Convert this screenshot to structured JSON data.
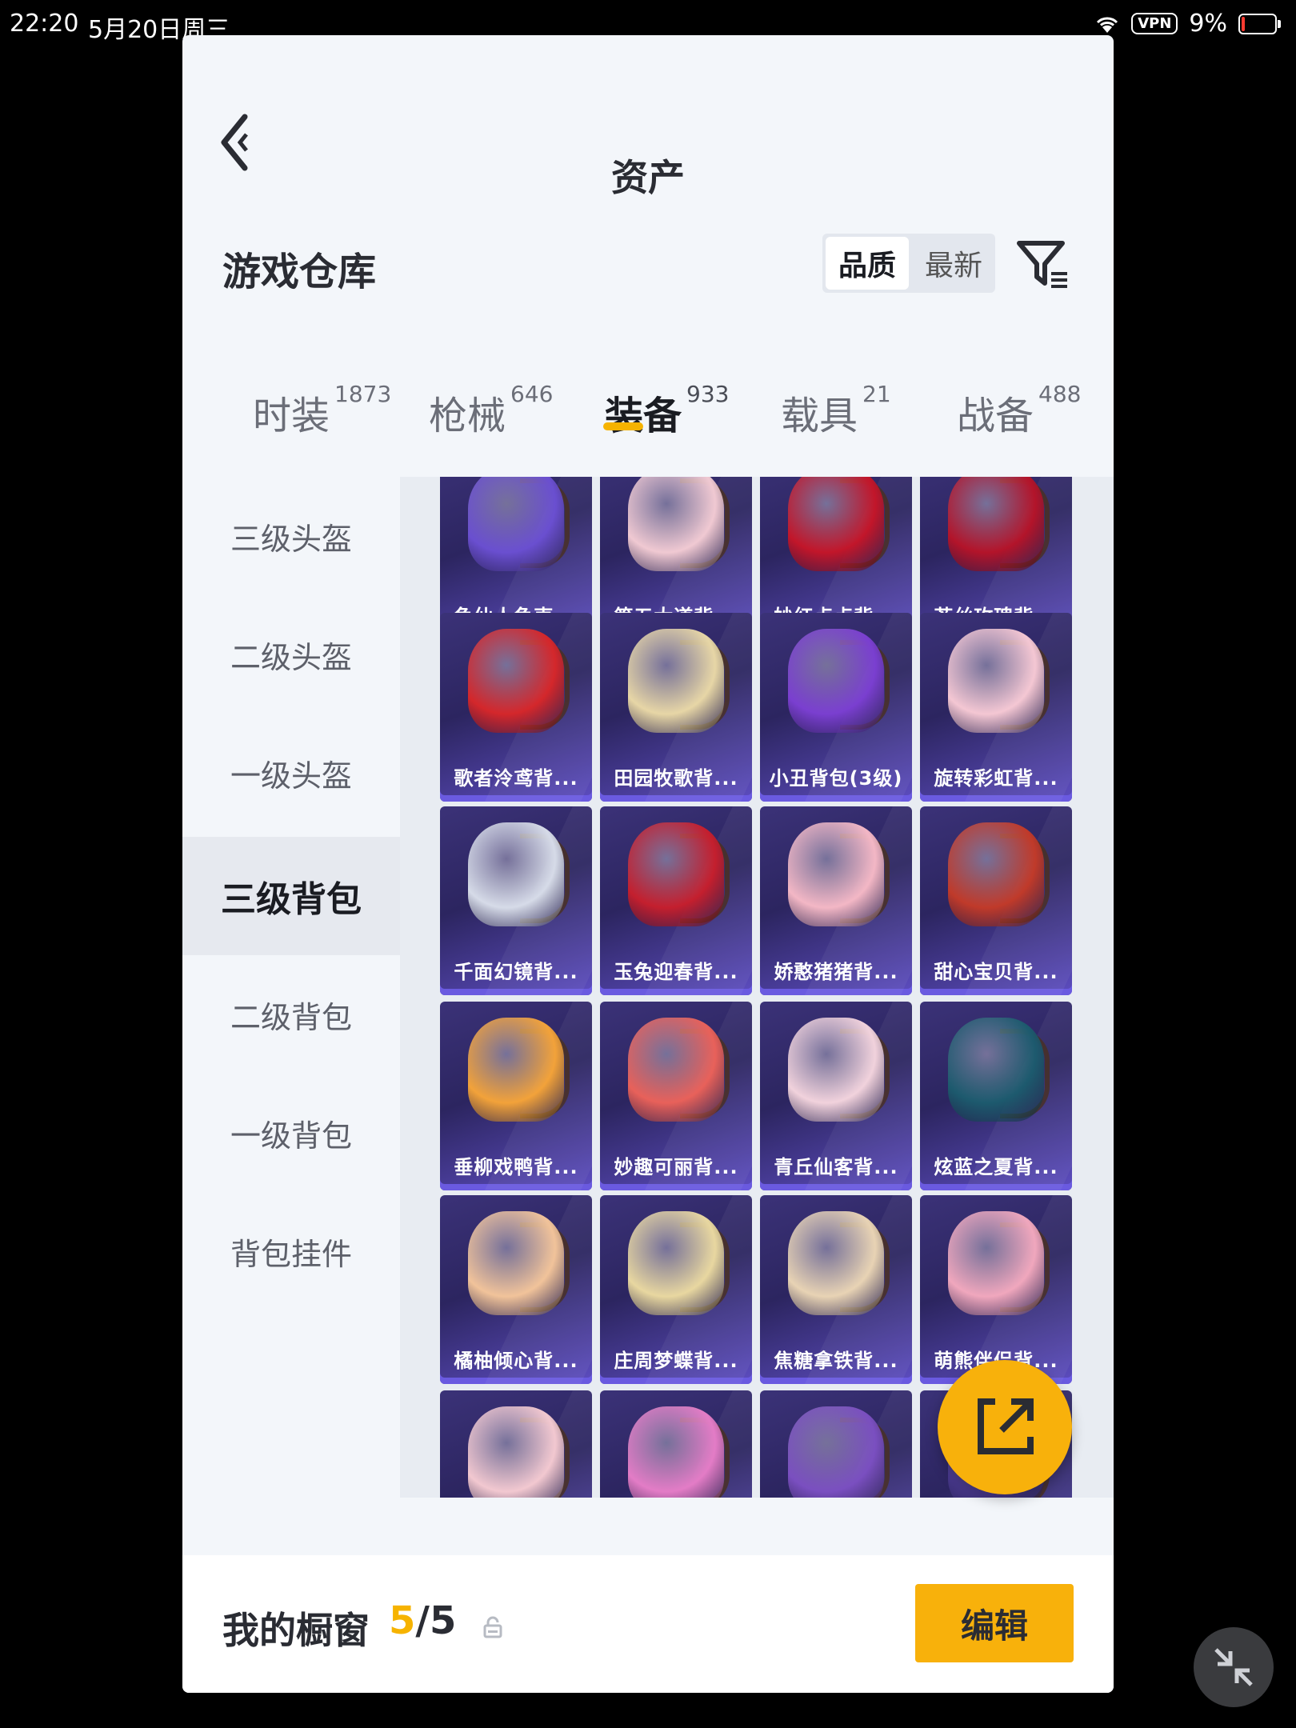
{
  "status_bar": {
    "time": "22:20",
    "date": "5月20日周三",
    "vpn": "VPN",
    "battery": "9%"
  },
  "header": {
    "title": "资产"
  },
  "warehouse": {
    "title": "游戏仓库",
    "sort": [
      "品质",
      "最新"
    ]
  },
  "tabs": [
    {
      "label": "时装",
      "count": "1873"
    },
    {
      "label": "枪械",
      "count": "646"
    },
    {
      "label": "装备",
      "count": "933"
    },
    {
      "label": "载具",
      "count": "21"
    },
    {
      "label": "战备",
      "count": "488"
    }
  ],
  "sidebar": [
    "三级头盔",
    "二级头盔",
    "一级头盔",
    "三级背包",
    "二级背包",
    "一级背包",
    "背包挂件"
  ],
  "items": [
    {
      "label": "龟仙人龟壳...",
      "color": "#6a4fd0"
    },
    {
      "label": "第五大道背...",
      "color": "#f0c9d2"
    },
    {
      "label": "妙红点点背...",
      "color": "#c2162a"
    },
    {
      "label": "苔丝玫瑰背...",
      "color": "#b3142a"
    },
    {
      "label": "歌者泠鸢背...",
      "color": "#d4272b"
    },
    {
      "label": "田园牧歌背...",
      "color": "#e7d6a6"
    },
    {
      "label": "小丑背包(3级)",
      "color": "#7a3fd0"
    },
    {
      "label": "旋转彩虹背...",
      "color": "#f4c7d3"
    },
    {
      "label": "千面幻镜背...",
      "color": "#d6dbe8"
    },
    {
      "label": "玉兔迎春背...",
      "color": "#c41f2e"
    },
    {
      "label": "娇憨猪猪背...",
      "color": "#f3b7c5"
    },
    {
      "label": "甜心宝贝背...",
      "color": "#c03a2a"
    },
    {
      "label": "垂柳戏鸭背...",
      "color": "#f2a23a"
    },
    {
      "label": "妙趣可丽背...",
      "color": "#e8615a"
    },
    {
      "label": "青丘仙客背...",
      "color": "#f1d2dc"
    },
    {
      "label": "炫蓝之夏背...",
      "color": "#1d5a6e"
    },
    {
      "label": "橘柚倾心背...",
      "color": "#f1c39a"
    },
    {
      "label": "庄周梦蝶背...",
      "color": "#e8d7a0"
    },
    {
      "label": "焦糖拿铁背...",
      "color": "#e8d3b4"
    },
    {
      "label": "萌熊伴侣背...",
      "color": "#f0a7bd"
    },
    {
      "label": "",
      "color": "#f2c8d0"
    },
    {
      "label": "",
      "color": "#e37cc6"
    },
    {
      "label": "",
      "color": "#7a4fc0"
    },
    {
      "label": "",
      "color": "#4a3a90"
    }
  ],
  "showcase": {
    "title": "我的橱窗",
    "current": "5",
    "separator": "/",
    "total": "5"
  },
  "edit_label": "编辑"
}
